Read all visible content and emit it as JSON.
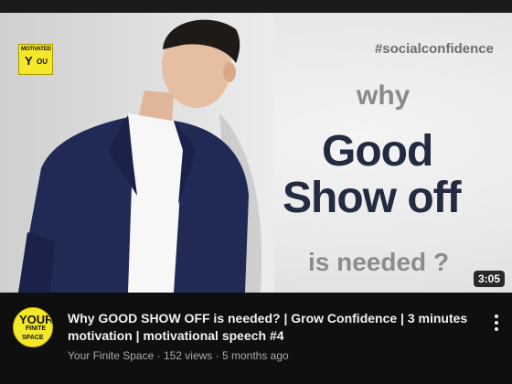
{
  "thumbnail": {
    "badge_top": "MOTIVATED",
    "badge_y": "Y",
    "badge_ou": "OU",
    "hashtag": "#socialconfidence",
    "line_why": "why",
    "line_good": "Good",
    "line_show": "Show off",
    "line_needed": "is needed ?",
    "duration": "3:05"
  },
  "channel_avatar": {
    "l1": "YOUR",
    "l2": "FINITE",
    "l3": "SPACE"
  },
  "video": {
    "title": "Why GOOD SHOW OFF is needed? | Grow Confidence | 3 minutes motivation | motivational speech #4",
    "meta": "Your Finite Space · 152 views · 5 months ago"
  },
  "icons": {
    "more": "more-vert-icon"
  },
  "colors": {
    "background": "#0f0f0f",
    "title_text": "#f1f1f1",
    "meta_text": "#aaaaaa",
    "brand_yellow": "#f5e72a",
    "thumb_dark_text": "#232b40"
  }
}
